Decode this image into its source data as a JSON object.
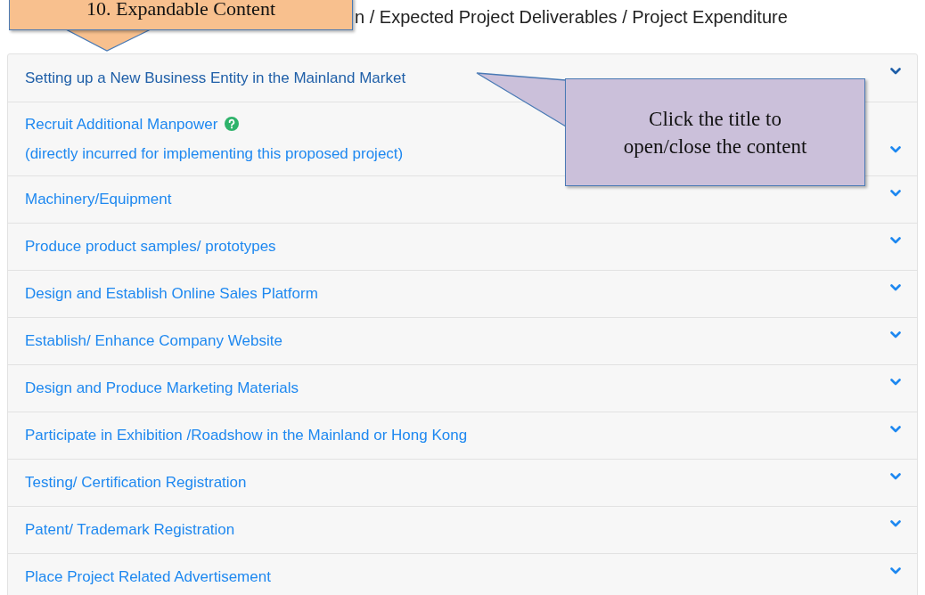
{
  "heading": "n / Expected Project Deliverables / Project Expenditure",
  "callouts": [
    {
      "kind": "section",
      "text": "10. Expandable Content"
    },
    {
      "kind": "hint",
      "text": "Click the title to open/close the content"
    }
  ],
  "accordion": [
    {
      "title": "Setting up a New Business Entity in the Mainland Market",
      "active": true,
      "help": false
    },
    {
      "title": "Recruit Additional Manpower",
      "subtitle": "(directly incurred for implementing this proposed project)",
      "active": false,
      "help": true
    },
    {
      "title": "Machinery/Equipment",
      "active": false,
      "help": false
    },
    {
      "title": "Produce product samples/ prototypes",
      "active": false,
      "help": false
    },
    {
      "title": "Design and Establish Online Sales Platform",
      "active": false,
      "help": false
    },
    {
      "title": "Establish/ Enhance Company Website",
      "active": false,
      "help": false
    },
    {
      "title": "Design and Produce Marketing Materials",
      "active": false,
      "help": false
    },
    {
      "title": "Participate in Exhibition /Roadshow in the Mainland or Hong Kong",
      "active": false,
      "help": false
    },
    {
      "title": "Testing/ Certification Registration",
      "active": false,
      "help": false
    },
    {
      "title": "Patent/ Trademark Registration",
      "active": false,
      "help": false
    },
    {
      "title": "Place Project Related Advertisement",
      "active": false,
      "help": false
    }
  ]
}
